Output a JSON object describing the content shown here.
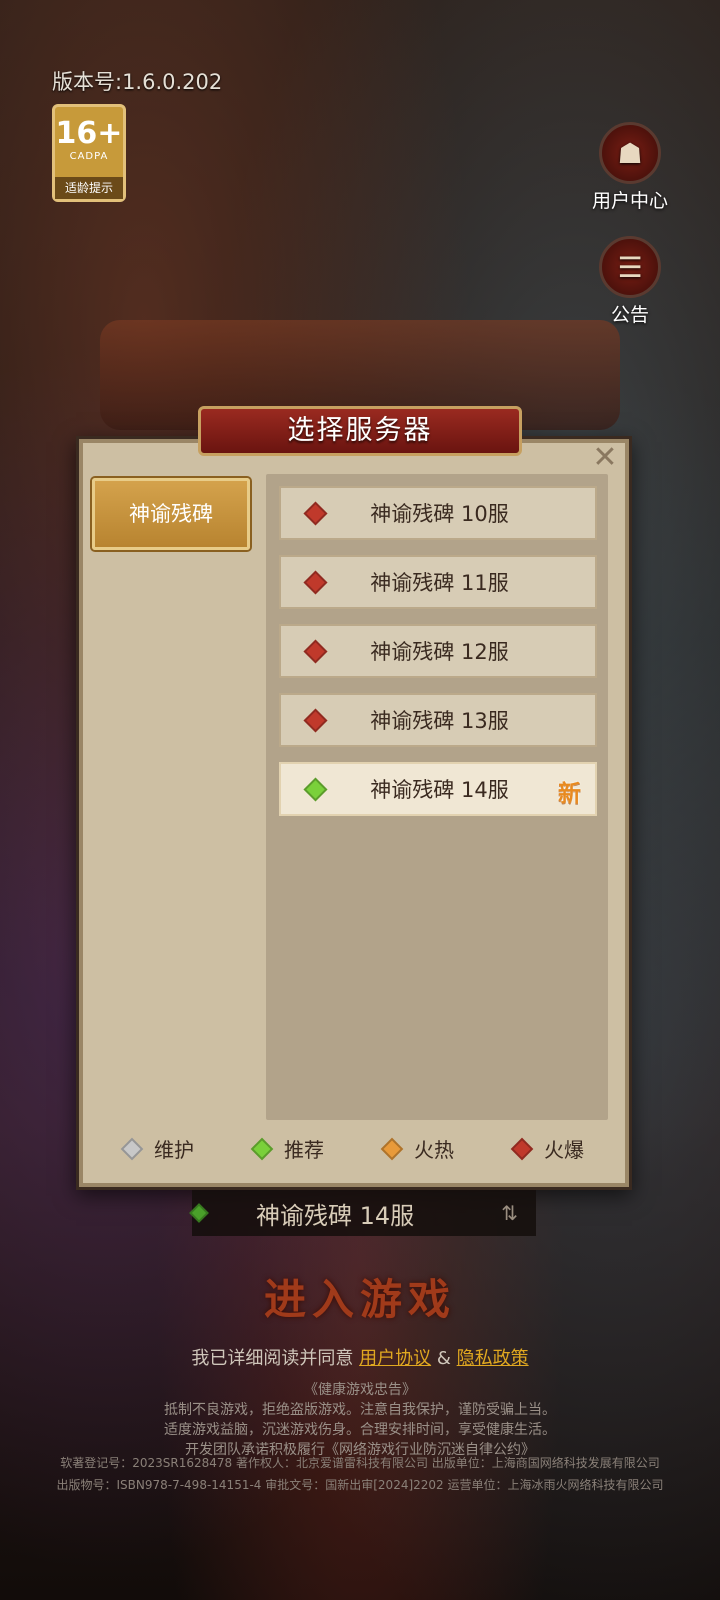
{
  "version": "版本号:1.6.0.202",
  "age_badge": {
    "number": "16+",
    "org": "CADPA",
    "hint": "适龄提示"
  },
  "side_buttons": {
    "user_center": "用户中心",
    "notice": "公告"
  },
  "dialog": {
    "title": "选择服务器",
    "close_icon": "close-icon",
    "region": "神谕残碑",
    "servers": [
      {
        "label": "神谕残碑 10服",
        "status": "hot-explosive",
        "color": "#c0392b"
      },
      {
        "label": "神谕残碑 11服",
        "status": "hot-explosive",
        "color": "#c0392b"
      },
      {
        "label": "神谕残碑 12服",
        "status": "hot-explosive",
        "color": "#c0392b"
      },
      {
        "label": "神谕残碑 13服",
        "status": "hot-explosive",
        "color": "#c0392b"
      },
      {
        "label": "神谕残碑 14服",
        "status": "recommended",
        "color": "#7ad03a",
        "new_tag": "新"
      }
    ],
    "legend": [
      {
        "label": "维护",
        "color": "#c8c8c8"
      },
      {
        "label": "推荐",
        "color": "#7ad03a"
      },
      {
        "label": "火热",
        "color": "#e89a3a"
      },
      {
        "label": "火爆",
        "color": "#c0392b"
      }
    ]
  },
  "current_server": {
    "label": "神谕残碑 14服",
    "switch_icon": "⇅"
  },
  "enter_button": "进入游戏",
  "agreement": {
    "prefix": "我已详细阅读并同意",
    "user_agreement": "用户协议",
    "amp": "&",
    "privacy": "隐私政策"
  },
  "health_notice": {
    "title": "《健康游戏忠告》",
    "line1": "抵制不良游戏，拒绝盗版游戏。注意自我保护，谨防受骗上当。",
    "line2": "适度游戏益脑，沉迷游戏伤身。合理安排时间，享受健康生活。",
    "line3": "开发团队承诺积极履行《网络游戏行业防沉迷自律公约》"
  },
  "legal": {
    "line1": "软著登记号：2023SR1628478  著作权人：北京爱谱雷科技有限公司  出版单位：上海商国网络科技发展有限公司",
    "line2": "出版物号：ISBN978-7-498-14151-4 审批文号：国新出审[2024]2202 运营单位：上海冰雨火网络科技有限公司"
  }
}
